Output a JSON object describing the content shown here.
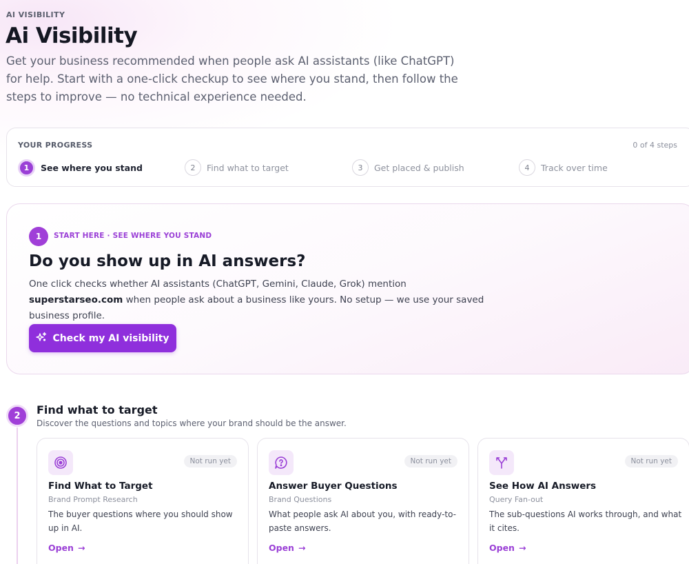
{
  "header": {
    "eyebrow": "AI VISIBILITY",
    "title": "Ai Visibility",
    "description": "Get your business recommended when people ask AI assistants (like ChatGPT) for help. Start with a one-click checkup to see where you stand, then follow the steps to improve — no technical experience needed."
  },
  "progress": {
    "label": "YOUR PROGRESS",
    "count": "0 of 4 steps",
    "steps": [
      {
        "num": "1",
        "label": "See where you stand"
      },
      {
        "num": "2",
        "label": "Find what to target"
      },
      {
        "num": "3",
        "label": "Get placed & publish"
      },
      {
        "num": "4",
        "label": "Track over time"
      }
    ]
  },
  "hero": {
    "step_num": "1",
    "eyebrow": "START HERE · SEE WHERE YOU STAND",
    "title": "Do you show up in AI answers?",
    "desc_before": "One click checks whether AI assistants (ChatGPT, Gemini, Claude, Grok) mention ",
    "domain": "superstarseo.com",
    "desc_after": " when people ask about a business like yours. No setup — we use your saved business profile.",
    "cta_label": "Check my AI visibility"
  },
  "section2": {
    "num": "2",
    "title": "Find what to target",
    "desc": "Discover the questions and topics where your brand should be the answer.",
    "tools": [
      {
        "icon": "target-icon",
        "status": "Not run yet",
        "name": "Find What to Target",
        "sub": "Brand Prompt Research",
        "desc": "The buyer questions where you should show up in AI.",
        "open": "Open"
      },
      {
        "icon": "question-bubble-icon",
        "status": "Not run yet",
        "name": "Answer Buyer Questions",
        "sub": "Brand Questions",
        "desc": "What people ask AI about you, with ready-to-paste answers.",
        "open": "Open"
      },
      {
        "icon": "fan-out-icon",
        "status": "Not run yet",
        "name": "See How AI Answers",
        "sub": "Query Fan-out",
        "desc": "The sub-questions AI works through, and what it cites.",
        "open": "Open"
      }
    ]
  },
  "colors": {
    "accent": "#9a3fd6",
    "button": "#8f2fdc"
  }
}
